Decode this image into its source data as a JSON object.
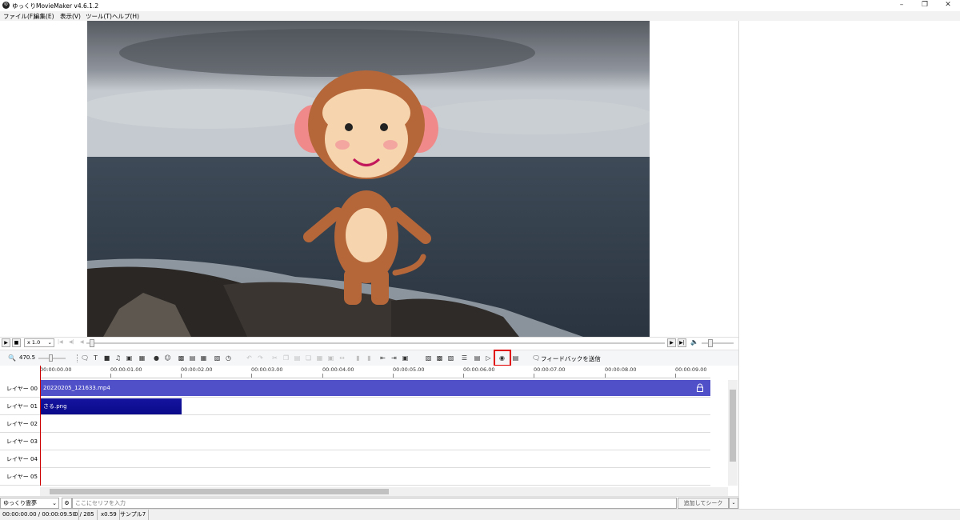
{
  "window": {
    "title": "ゆっくりMovieMaker v4.6.1.2",
    "icon_label": "ゆ"
  },
  "menu": [
    "ファイル(F)",
    "編集(E)",
    "表示(V)",
    "ツール(T)",
    "ヘルプ(H)"
  ],
  "player": {
    "speed": "x 1.0"
  },
  "toolbar": {
    "zoom": "470.5",
    "feedback_label": "フィードバックを送信"
  },
  "timeline": {
    "ruler": [
      "00:00:00.00",
      "00:00:01.00",
      "00:00:02.00",
      "00:00:03.00",
      "00:00:04.00",
      "00:00:05.00",
      "00:00:06.00",
      "00:00:07.00",
      "00:00:08.00",
      "00:00:09.00"
    ],
    "layers": [
      "レイヤー 00",
      "レイヤー 01",
      "レイヤー 02",
      "レイヤー 03",
      "レイヤー 04",
      "レイヤー 05"
    ],
    "clips": {
      "video": "20220205_121633.mp4",
      "image": "さる.png"
    }
  },
  "input": {
    "character": "ゆっくり霊夢",
    "placeholder": "ここにセリフを入力",
    "add_button": "追加してシーク"
  },
  "status": {
    "time": "00:00:00.00 / 00:00:09.50",
    "frame": "0 / 285",
    "scale": "x0.59",
    "sample": "サンプル7"
  },
  "icons": {
    "camera": "camera-icon",
    "lock": "lock-icon"
  },
  "colors": {
    "video_clip": "#5050c8",
    "image_clip": "#0a0a8a",
    "highlight": "#e00000",
    "playhead": "#cc0000"
  }
}
